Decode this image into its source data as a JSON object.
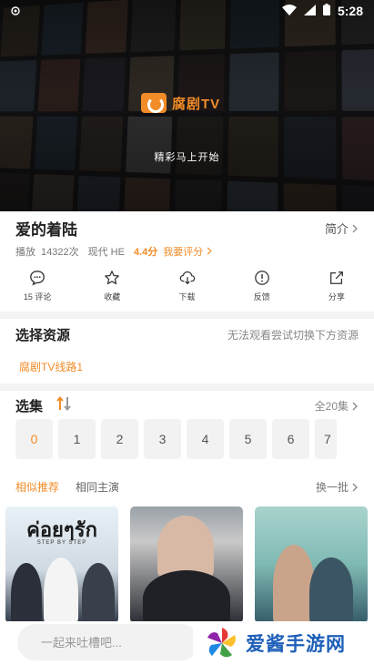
{
  "status_bar": {
    "time": "5:28"
  },
  "hero": {
    "logo_text": "腐剧TV",
    "tagline": "精彩马上开始"
  },
  "show": {
    "title": "爱的着陆",
    "intro_label": "简介",
    "plays_label": "播放",
    "plays": "14322次",
    "genre": "现代 HE",
    "score": "4.4分",
    "rate_label": "我要评分"
  },
  "actions": [
    {
      "label": "15 评论",
      "icon": "comment-icon"
    },
    {
      "label": "收藏",
      "icon": "star-icon"
    },
    {
      "label": "下载",
      "icon": "cloud-download-icon"
    },
    {
      "label": "反馈",
      "icon": "alert-icon"
    },
    {
      "label": "分享",
      "icon": "share-icon"
    }
  ],
  "source": {
    "title": "选择资源",
    "note": "无法观看尝试切换下方资源",
    "lines": [
      "腐剧TV线路1"
    ]
  },
  "episodes": {
    "title": "选集",
    "all_label": "全20集",
    "items": [
      "0",
      "1",
      "2",
      "3",
      "4",
      "5",
      "6",
      "7"
    ],
    "selected": "0"
  },
  "recommend": {
    "tabs": [
      "相似推荐",
      "相同主演"
    ],
    "active_tab": "相似推荐",
    "refresh_label": "换一批",
    "cards": [
      {
        "title_text": "ค่อยๆรัก",
        "subtitle_text": "STEP BY STEP"
      },
      {
        "title_text": ""
      },
      {
        "title_text": ""
      }
    ]
  },
  "comment": {
    "placeholder": "一起来吐槽吧..."
  },
  "watermark": {
    "text": "爱酱手游网"
  },
  "colors": {
    "accent": "#f28c28",
    "watermark": "#1d5fb8"
  }
}
